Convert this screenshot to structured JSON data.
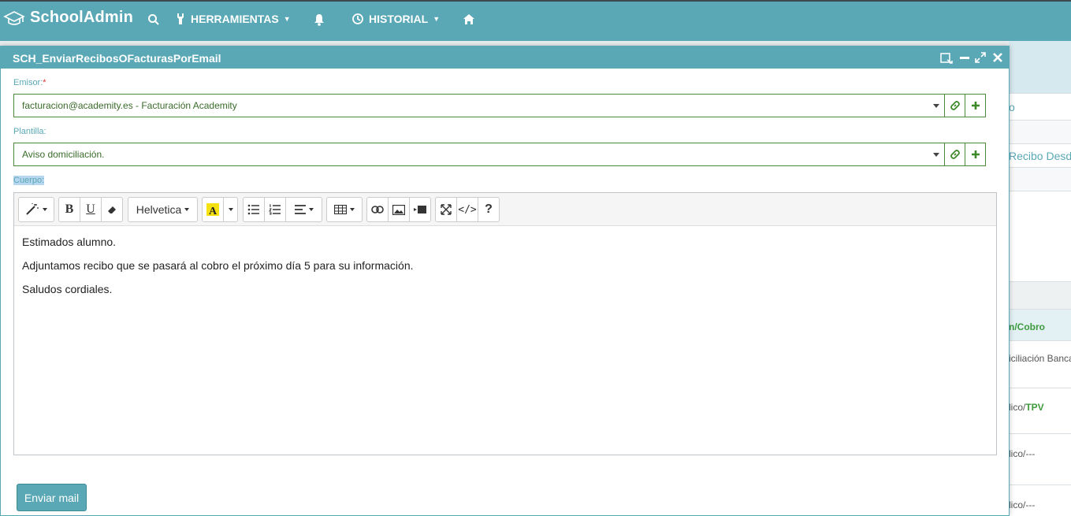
{
  "app": {
    "brand": "SchoolAdmin",
    "nav": {
      "tools_label": "HERRAMIENTAS",
      "history_label": "HISTORIAL"
    }
  },
  "background": {
    "link_partial": "o",
    "recibo_link": "Recibo Desd",
    "rows": [
      {
        "prefix": "",
        "green": "n/Cobro"
      },
      {
        "prefix": "iciliación Banca",
        "green": ""
      },
      {
        "prefix": "lico/",
        "green": "TPV"
      },
      {
        "prefix": "lico/---",
        "green": ""
      },
      {
        "prefix": "lico/---",
        "green": ""
      }
    ]
  },
  "dialog": {
    "title": "SCH_EnviarRecibosOFacturasPorEmail",
    "emisor": {
      "label": "Emisor:",
      "required_mark": "*",
      "value": "facturacion@academity.es - Facturación Academity"
    },
    "plantilla": {
      "label": "Plantilla:",
      "value": "Aviso domiciliación."
    },
    "cuerpo": {
      "label": "Cuerpo:"
    },
    "toolbar": {
      "font_name": "Helvetica",
      "bold": "B",
      "underline": "U",
      "help": "?",
      "code": "</>"
    },
    "body_paragraphs": [
      "Estimados alumno.",
      "Adjuntamos recibo que se pasará al cobro el próximo día 5 para su información.",
      "Saludos cordiales."
    ],
    "send_button": "Enviar mail"
  }
}
